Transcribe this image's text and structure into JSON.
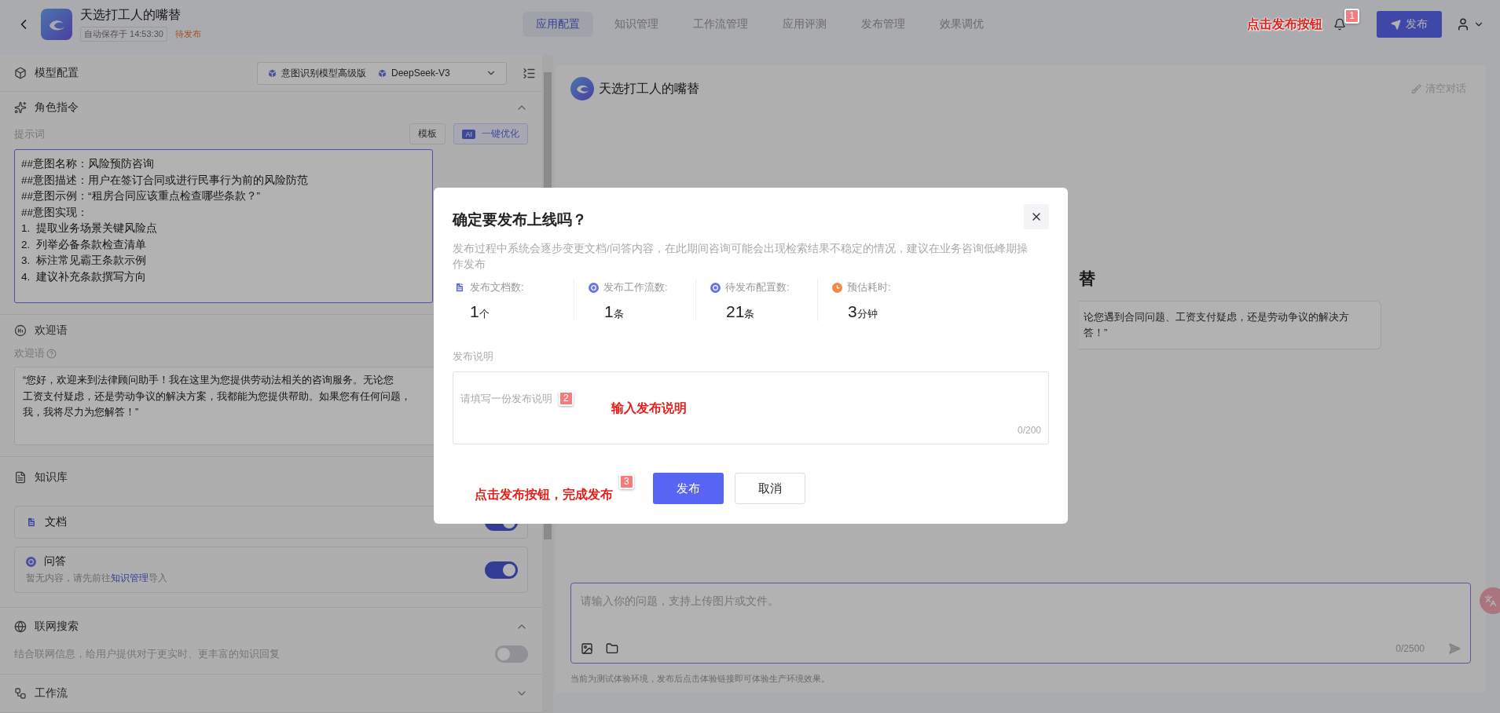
{
  "header": {
    "title": "天选打工人的嘴替",
    "autosave": "自动保存于 14:53:30",
    "status": "待发布",
    "tabs": [
      {
        "label": "应用配置",
        "selected": true
      },
      {
        "label": "知识管理",
        "selected": false
      },
      {
        "label": "工作流管理",
        "selected": false
      },
      {
        "label": "应用评测",
        "selected": false
      },
      {
        "label": "发布管理",
        "selected": false
      },
      {
        "label": "效果调优",
        "selected": false
      }
    ],
    "publish_button": "发布"
  },
  "left_panel": {
    "model_config": {
      "title": "模型配置",
      "models": [
        "意图识别模型高级版",
        "DeepSeek-V3"
      ]
    },
    "role_instruction": {
      "title": "角色指令",
      "expanded": true,
      "prompt_label": "提示词",
      "template_button": "模板",
      "ai_badge": "AI",
      "optimize_button": "一键优化",
      "prompt_lines": [
        "##意图名称：风险预防咨询",
        "##意图描述：用户在签订合同或进行民事行为前的风险防范",
        "##意图示例：“租房合同应该重点检查哪些条款？”",
        "##意图实现：",
        "1.  提取业务场景关键风险点",
        "2.  列举必备条款检查清单",
        "3.  标注常见霸王条款示例",
        "4.  建议补充条款撰写方向"
      ]
    },
    "welcome": {
      "title": "欢迎语",
      "label": "欢迎语",
      "text_lines": [
        "“您好，欢迎来到法律顾问助手！我在这里为您提供劳动法相关的咨询服务。无论您",
        "工资支付疑虑，还是劳动争议的解决方案，我都能为您提供帮助。如果您有任何问题，",
        "我，我将尽力为您解答！”"
      ]
    },
    "knowledge": {
      "title": "知识库",
      "items": [
        {
          "kind": "doc",
          "name": "文档",
          "on": true
        },
        {
          "kind": "qa",
          "name": "问答",
          "on": true,
          "hint": {
            "before": "暂无内容，请先前往",
            "link": "知识管理",
            "after": "导入"
          }
        }
      ]
    },
    "web_search": {
      "title": "联网搜索",
      "expanded": true,
      "description": "结合联网信息，给用户提供对于更实时、更丰富的知识回复",
      "on": false
    },
    "workflow": {
      "title": "工作流",
      "expanded": false
    }
  },
  "chat": {
    "title": "天选打工人的嘴替",
    "clear_button": "清空对话",
    "welcome_title": "替",
    "welcome_lines": [
      "论您遇到合同问题、工资支付疑虑，还是劳动争议的解决方",
      "答！”"
    ],
    "input": {
      "placeholder": "请输入你的问题，支持上传图片或文件。",
      "counter": "0/2500"
    },
    "footer_note": "当前为测试体验环境，发布后点击体验链接即可体验生产环境效果。"
  },
  "dialog": {
    "title": "确定要发布上线吗？",
    "description": "发布过程中系统会逐步变更文档/问答内容，在此期间咨询可能会出现检索结果不稳定的情况，建议在业务咨询低峰期操作发布",
    "stats": [
      {
        "kind": "doc",
        "label": "发布文档数:",
        "value": "1",
        "unit": "个"
      },
      {
        "kind": "qa",
        "label": "发布工作流数:",
        "value": "1",
        "unit": "条"
      },
      {
        "kind": "qa",
        "label": "待发布配置数:",
        "value": "21",
        "unit": "条"
      },
      {
        "kind": "clock",
        "label": "预估耗时:",
        "value": "3",
        "unit": "分钟"
      }
    ],
    "note_label": "发布说明",
    "note": {
      "placeholder": "请填写一份发布说明",
      "counter": "0/200"
    },
    "buttons": [
      {
        "kind": "primary",
        "label": "发布"
      },
      {
        "kind": "default",
        "label": "取消"
      }
    ]
  },
  "annotations": [
    {
      "number": "1",
      "text": "点击发布按钮"
    },
    {
      "number": "2",
      "text": "输入发布说明"
    },
    {
      "number": "3",
      "text": "点击发布按钮，完成发布"
    }
  ]
}
